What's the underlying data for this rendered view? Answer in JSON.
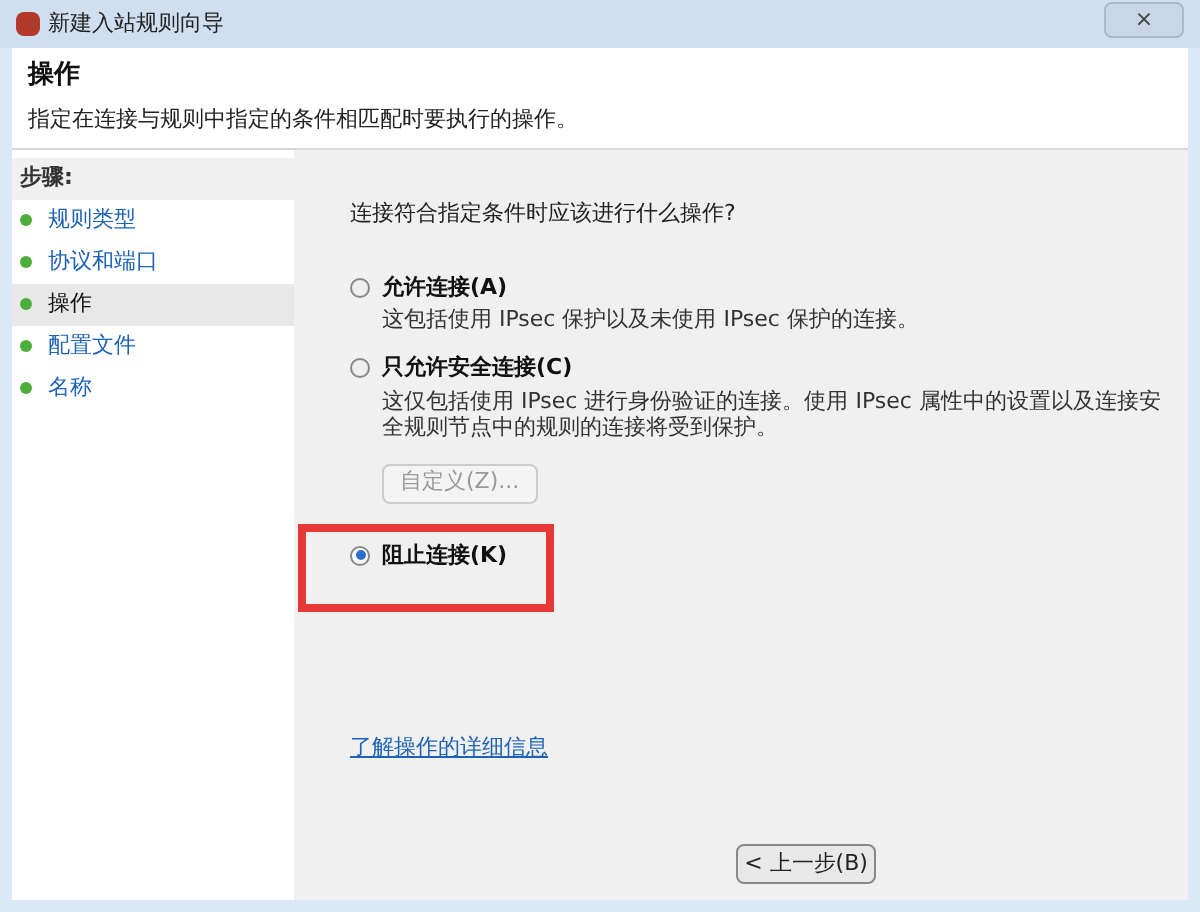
{
  "window": {
    "title": "新建入站规则向导",
    "close": "×"
  },
  "header": {
    "title": "操作",
    "description": "指定在连接与规则中指定的条件相匹配时要执行的操作。"
  },
  "steps": {
    "title": "步骤:",
    "items": [
      {
        "label": "规则类型",
        "selected": false
      },
      {
        "label": "协议和端口",
        "selected": false
      },
      {
        "label": "操作",
        "selected": true
      },
      {
        "label": "配置文件",
        "selected": false
      },
      {
        "label": "名称",
        "selected": false
      }
    ]
  },
  "question": "连接符合指定条件时应该进行什么操作?",
  "options": [
    {
      "label": "允许连接(A)",
      "description": "这包括使用 IPsec 保护以及未使用 IPsec 保护的连接。",
      "selected": false,
      "highlighted": false
    },
    {
      "label": "只允许安全连接(C)",
      "description": "这仅包括使用 IPsec 进行身份验证的连接。使用 IPsec 属性中的设置以及连接安全规则节点中的规则的连接将受到保护。",
      "selected": false,
      "highlighted": false,
      "button": {
        "label": "自定义(Z)...",
        "disabled": true
      }
    },
    {
      "label": "阻止连接(K)",
      "selected": true,
      "highlighted": true
    }
  ],
  "link": "了解操作的详细信息",
  "footer": {
    "back": "< 上一步(B)"
  }
}
